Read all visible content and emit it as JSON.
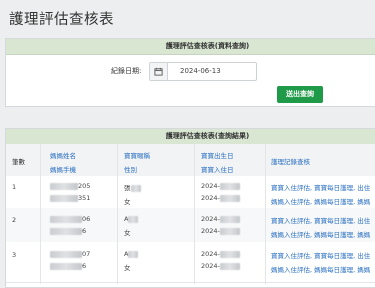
{
  "page": {
    "title": "護理評估查核表"
  },
  "query": {
    "header": "護理評估查核表(資料查詢)",
    "date_label": "紀錄日期:",
    "date_value": "2024-06-13",
    "export_button": "送出查詢"
  },
  "results": {
    "header": "護理評估查核表(查詢結果)",
    "columns": {
      "index": "筆數",
      "mother_name": "媽媽姓名",
      "mother_phone": "媽媽手機",
      "baby_name": "寶寶暱稱",
      "baby_gender": "性別",
      "baby_birth": "寶寶出生日",
      "baby_checkin": "寶寶入住日",
      "records": "護理記錄查核"
    },
    "rows": [
      {
        "index": "1",
        "name_suffix": "205",
        "phone_suffix": "351",
        "baby_name": "張",
        "gender": "女",
        "birth": "2024-",
        "checkin": "2024-",
        "links_line1": "寶寶入住評估, 寶寶每日護理, 出住",
        "links_line2": "媽媽入住評估, 媽媽每日護理, 媽媽"
      },
      {
        "index": "2",
        "name_suffix": "06",
        "phone_suffix": "6",
        "baby_name": "A",
        "gender": "女",
        "birth": "2024-",
        "checkin": "2024-",
        "links_line1": "寶寶入住評估, 寶寶每日護理, 出住",
        "links_line2": "媽媽入住評估, 媽媽每日護理, 媽媽"
      },
      {
        "index": "3",
        "name_suffix": "07",
        "phone_suffix": "6",
        "baby_name": "A",
        "gender": "女",
        "birth": "2024-",
        "checkin": "2024-",
        "links_line1": "寶寶入住評估, 寶寶每日護理, 出住",
        "links_line2": "媽媽入住評估, 媽媽每日護理, 媽媽"
      }
    ]
  },
  "icons": {
    "calendar": "calendar-icon"
  },
  "colors": {
    "header_bg": "#d8e6d2",
    "accent_button": "#1f9a48",
    "link": "#2a6fc2"
  }
}
